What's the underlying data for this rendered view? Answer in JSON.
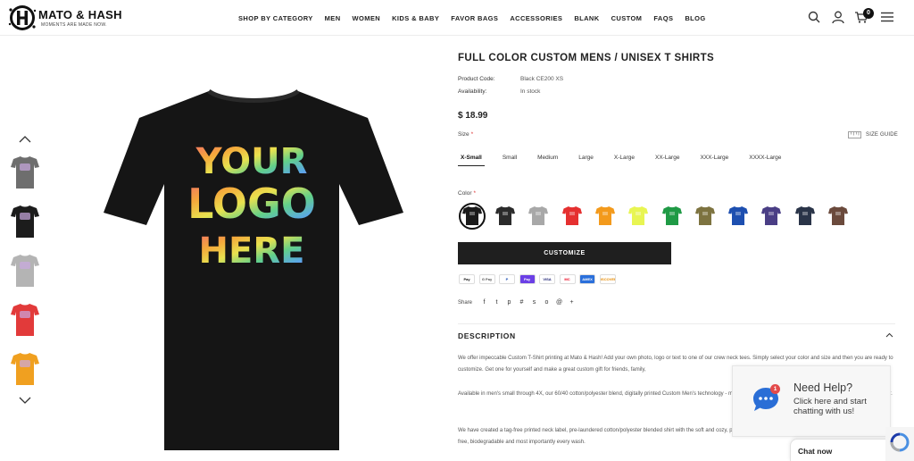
{
  "header": {
    "logo_name": "MATO & HASH",
    "logo_tagline": "MOMENTS ARE MADE NOW.",
    "nav": [
      "SHOP BY CATEGORY",
      "MEN",
      "WOMEN",
      "KIDS & BABY",
      "FAVOR BAGS",
      "ACCESSORIES",
      "BLANK",
      "CUSTOM",
      "FAQS",
      "BLOG"
    ],
    "cart_count": "0"
  },
  "gallery": {
    "thumbnails": [
      {
        "color": "#6e6e6e",
        "icon": "gray-tshirt-thumbnail"
      },
      {
        "color": "#1c1c1c",
        "icon": "black-tshirt-thumbnail"
      },
      {
        "color": "#b4b4b4",
        "icon": "light-gray-tshirt-thumbnail"
      },
      {
        "color": "#e23a3a",
        "icon": "red-tshirt-thumbnail"
      },
      {
        "color": "#f0a020",
        "icon": "orange-tshirt-thumbnail"
      }
    ],
    "main_print": [
      "YOUR",
      "LOGO",
      "HERE"
    ]
  },
  "product": {
    "title": "FULL COLOR CUSTOM MENS / UNISEX T SHIRTS",
    "code_label": "Product Code:",
    "code_value": "Black CE200 XS",
    "availability_label": "Availability:",
    "availability_value": "In stock",
    "price": "$ 18.99",
    "size_label": "Size",
    "required_mark": "*",
    "size_guide": "SIZE GUIDE",
    "sizes": [
      "X-Small",
      "Small",
      "Medium",
      "Large",
      "X-Large",
      "XX-Large",
      "XXX-Large",
      "XXXX-Large"
    ],
    "selected_size": "X-Small",
    "color_label": "Color",
    "colors": [
      "#1a1a1a",
      "#2b2b2b",
      "#a8a8a8",
      "#e53030",
      "#f39a1c",
      "#e8f552",
      "#1f9a45",
      "#7d7340",
      "#1d4fb0",
      "#4a3e85",
      "#2a3448",
      "#6b4a3c"
    ],
    "customize_button": "CUSTOMIZE",
    "payment_methods": [
      "Pay",
      "G Pay",
      "P",
      "Pay",
      "VISA",
      "MC",
      "AMEX",
      "DISCOVER"
    ],
    "share_label": "Share",
    "share_icons": [
      "f",
      "t",
      "p",
      "#",
      "s",
      "o",
      "@",
      "+"
    ]
  },
  "description": {
    "heading": "DESCRIPTION",
    "paragraphs": [
      "We offer impeccable Custom T-Shirt printing at Mato & Hash! Add your own photo, logo or text to one of our crew neck tees. Simply select your color and size and then you are ready to customize. Get one for yourself and make a great custom gift for friends, family,",
      "Available in men's small through 4X, our 60/40 cotton/polyester blend, digitally printed Custom Men's technology - meaning our clear, full color prints are well distributed and last longer.",
      "We have created a tag-free printed neck label, pre-laundered cotton/polyester blended shirt with the soft and cozy, providing comfort and confidence all day. Our inks are 100% toxin-free, biodegradable and most importantly every wash."
    ]
  },
  "chat": {
    "badge": "1",
    "help_title": "Need Help?",
    "help_subtitle": "Click here and start chatting with us!",
    "bar_label": "Chat now"
  }
}
